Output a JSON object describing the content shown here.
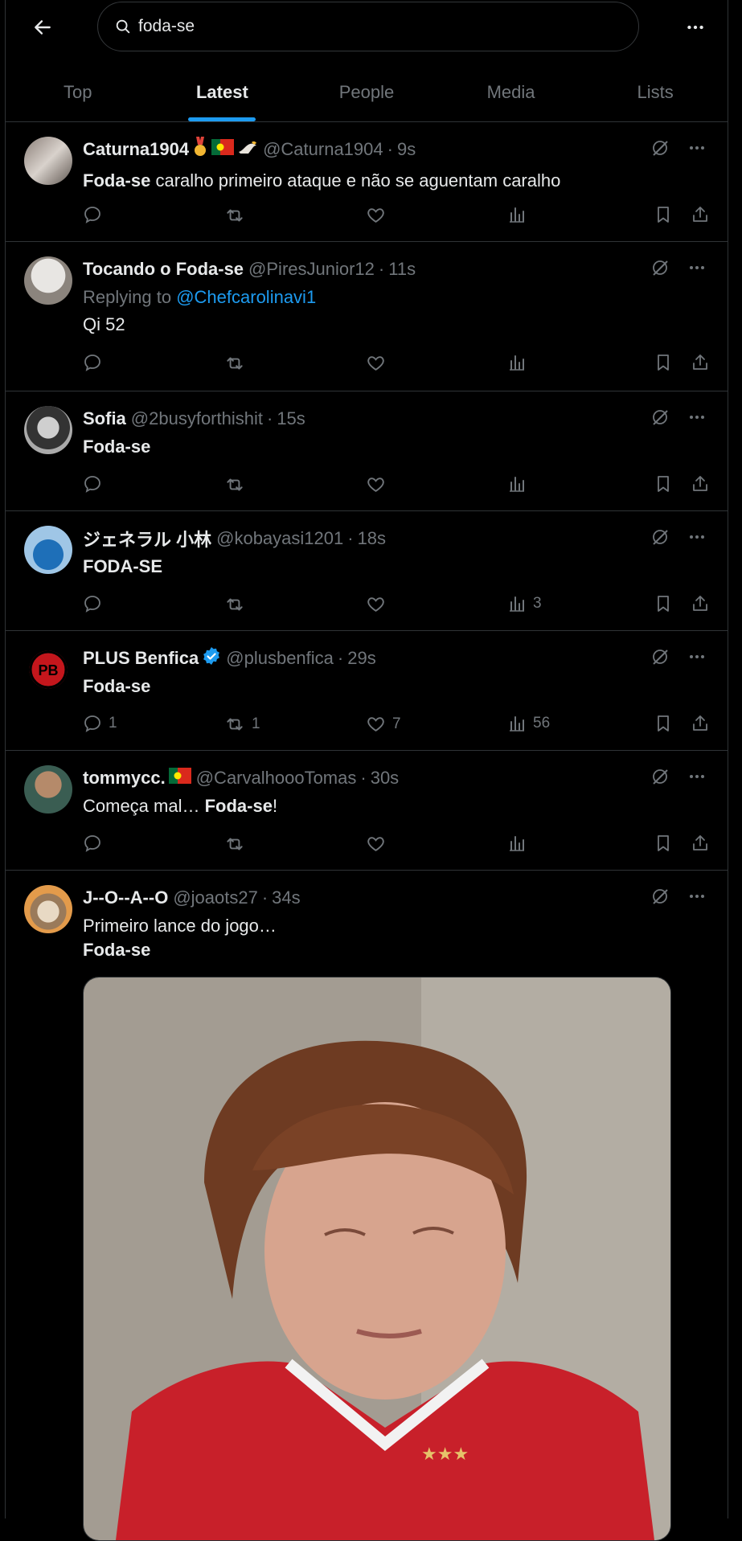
{
  "search": {
    "query": "foda-se"
  },
  "tabs": [
    {
      "label": "Top"
    },
    {
      "label": "Latest"
    },
    {
      "label": "People"
    },
    {
      "label": "Media"
    },
    {
      "label": "Lists"
    }
  ],
  "active_tab": "Latest",
  "colors": {
    "accent": "#1d9bf0",
    "muted": "#71767b",
    "text": "#e7e9ea",
    "border": "#2f3336"
  },
  "posts": [
    {
      "name": "Caturna1904",
      "handle": "@Caturna1904",
      "time": "9s",
      "text_bold": "Foda-se",
      "text_rest": " caralho primeiro ataque e não se aguentam caralho",
      "badges": [
        "medal-emoji",
        "portugal-flag-emoji",
        "eagle-emoji"
      ]
    },
    {
      "name": "Tocando o Foda-se",
      "handle": "@PiresJunior12",
      "time": "11s",
      "reply_prefix": "Replying to",
      "reply_handle": "@Chefcarolinavi1",
      "text": "Qi 52"
    },
    {
      "name": "Sofia",
      "handle": "@2busyforthishit",
      "time": "15s",
      "text_bold": "Foda-se"
    },
    {
      "name": "ジェネラル 小林",
      "handle": "@kobayasi1201",
      "time": "18s",
      "text_bold": "FODA-SE",
      "views": "3"
    },
    {
      "name": "PLUS Benfica",
      "handle": "@plusbenfica",
      "time": "29s",
      "text_bold": "Foda-se",
      "verified": true,
      "replies": "1",
      "reposts": "1",
      "likes": "7",
      "views": "56"
    },
    {
      "name": "tommycc.",
      "handle": "@CarvalhoooTomas",
      "time": "30s",
      "text_rest": "Começa mal… ",
      "text_bold": "Foda-se",
      "text_end": "!",
      "badges": [
        "portugal-flag-emoji"
      ]
    },
    {
      "name": "J--O--A--O",
      "handle": "@joaots27",
      "time": "34s",
      "text_line1": "Primeiro lance do jogo…",
      "text_bold": "Foda-se",
      "has_media": true
    }
  ]
}
